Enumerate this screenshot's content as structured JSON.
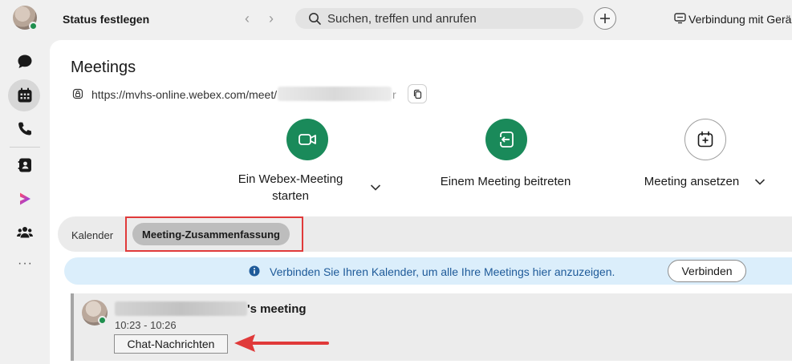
{
  "topbar": {
    "status_label": "Status festlegen",
    "search_placeholder": "Suchen, treffen und anrufen",
    "connect_device_label": "Verbindung mit Gerä"
  },
  "sidebar": {
    "items": [
      {
        "name": "messaging",
        "icon": "chat-bubble-icon",
        "active": false
      },
      {
        "name": "meetings",
        "icon": "calendar-icon",
        "active": true
      },
      {
        "name": "calling",
        "icon": "phone-icon",
        "active": false
      },
      {
        "name": "contacts",
        "icon": "contacts-icon",
        "active": false
      },
      {
        "name": "vidcast",
        "icon": "vidcast-icon",
        "active": false
      },
      {
        "name": "teams",
        "icon": "teams-icon",
        "active": false
      }
    ],
    "more_label": "···"
  },
  "main": {
    "title": "Meetings",
    "url": "https://mvhs-online.webex.com/meet/",
    "url_suffix": "r",
    "actions": [
      {
        "label_line1": "Ein Webex-Meeting",
        "label_line2": "starten",
        "icon": "video-camera-icon"
      },
      {
        "label_line1": "Einem Meeting beitreten",
        "icon": "join-meeting-icon"
      },
      {
        "label_line1": "Meeting ansetzen",
        "icon": "calendar-add-icon"
      }
    ],
    "tabs": [
      {
        "label": "Kalender",
        "active": false
      },
      {
        "label": "Meeting-Zusammenfassung",
        "active": true
      }
    ],
    "banner": {
      "text": "Verbinden Sie Ihren Kalender, um alle Ihre Meetings hier anzuzeigen.",
      "button_label": "Verbinden"
    },
    "meeting": {
      "title_suffix": "'s meeting",
      "time": "10:23 - 10:26",
      "chat_button_label": "Chat-Nachrichten"
    }
  },
  "colors": {
    "accent_green": "#1a8a5a",
    "highlight_red": "#e03a3a",
    "banner_blue": "#dbeefb",
    "banner_text": "#1e5a99"
  }
}
